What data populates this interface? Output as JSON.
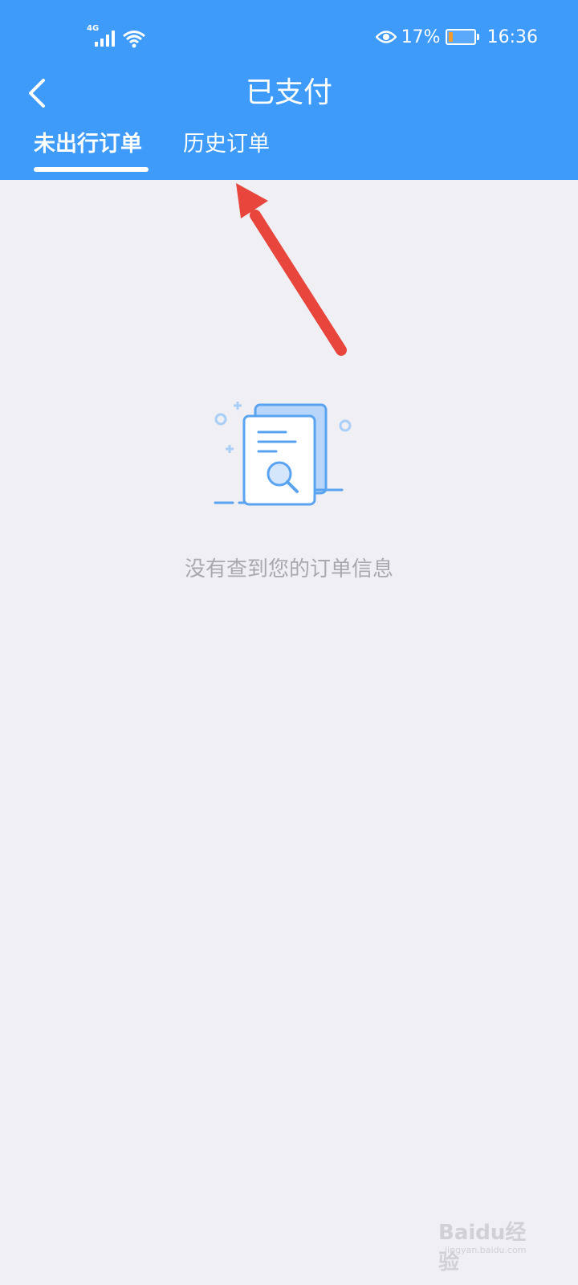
{
  "status_bar": {
    "network": "4G",
    "battery_percent": "17%",
    "battery_level": 0.17,
    "time": "16:36",
    "icons": [
      "signal-icon",
      "wifi-icon",
      "eye-icon",
      "battery-icon"
    ]
  },
  "header": {
    "title": "已支付",
    "back_icon": "chevron-left-icon"
  },
  "tabs": [
    {
      "label": "未出行订单",
      "active": true
    },
    {
      "label": "历史订单",
      "active": false
    }
  ],
  "empty_state": {
    "icon": "document-search-icon",
    "message": "没有查到您的订单信息"
  },
  "watermark": {
    "text": "Baidu经验",
    "sub": "jingyan.baidu.com"
  },
  "colors": {
    "header": "#3e9bf9",
    "background": "#efeff4",
    "annotation_arrow": "#e8453c",
    "illustration": "#5aa3f0"
  }
}
